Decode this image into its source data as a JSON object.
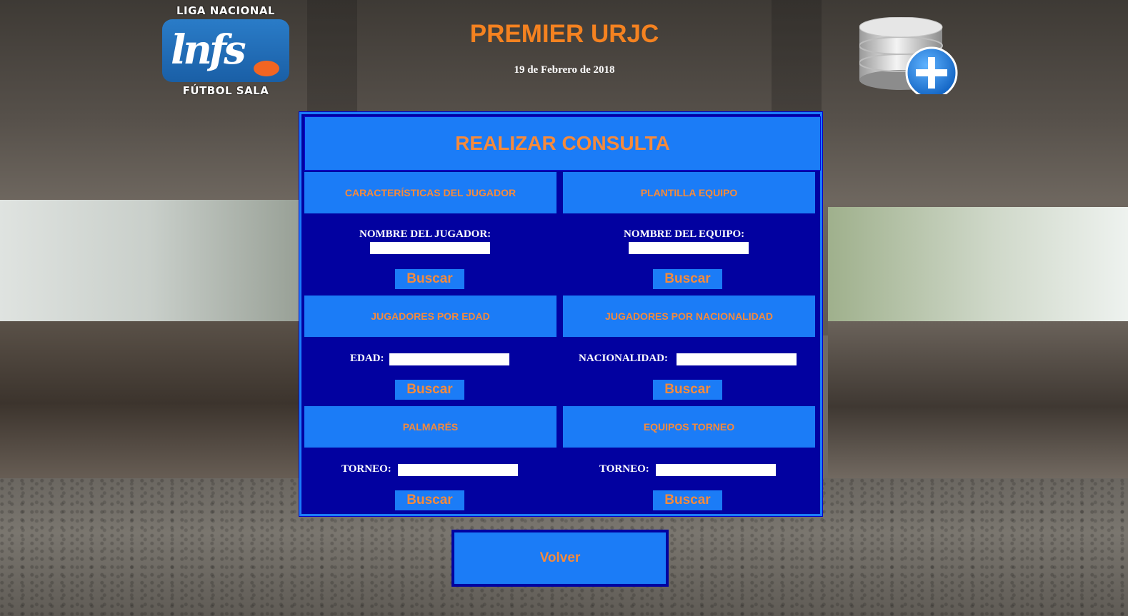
{
  "header": {
    "logo": {
      "top_text": "LIGA NACIONAL",
      "mark": "lnfs",
      "bottom_text": "FÚTBOL SALA"
    },
    "title": "PREMIER URJC",
    "date": "19 de Febrero de 2018",
    "db_icon": "database-add-icon"
  },
  "panel": {
    "title": "REALIZAR CONSULTA",
    "sections": [
      {
        "heading": "CARACTERÍSTICAS DEL JUGADOR",
        "field_label": "NOMBRE DEL JUGADOR:",
        "field_value": "",
        "button": "Buscar"
      },
      {
        "heading": "PLANTILLA EQUIPO",
        "field_label": "NOMBRE DEL EQUIPO:",
        "field_value": "",
        "button": "Buscar"
      },
      {
        "heading": "JUGADORES POR EDAD",
        "field_label": "EDAD:",
        "field_value": "",
        "button": "Buscar"
      },
      {
        "heading": "JUGADORES POR NACIONALIDAD",
        "field_label": "NACIONALIDAD:",
        "field_value": "",
        "button": "Buscar"
      },
      {
        "heading": "PALMARÉS",
        "field_label": "TORNEO:",
        "field_value": "",
        "button": "Buscar"
      },
      {
        "heading": "EQUIPOS TORNEO",
        "field_label": "TORNEO:",
        "field_value": "",
        "button": "Buscar"
      }
    ]
  },
  "footer": {
    "back_button": "Volver"
  },
  "colors": {
    "panel_bg": "#0201a0",
    "section_bg": "#1b7cf7",
    "accent_orange": "#f58a3c",
    "title_orange": "#f58220"
  }
}
